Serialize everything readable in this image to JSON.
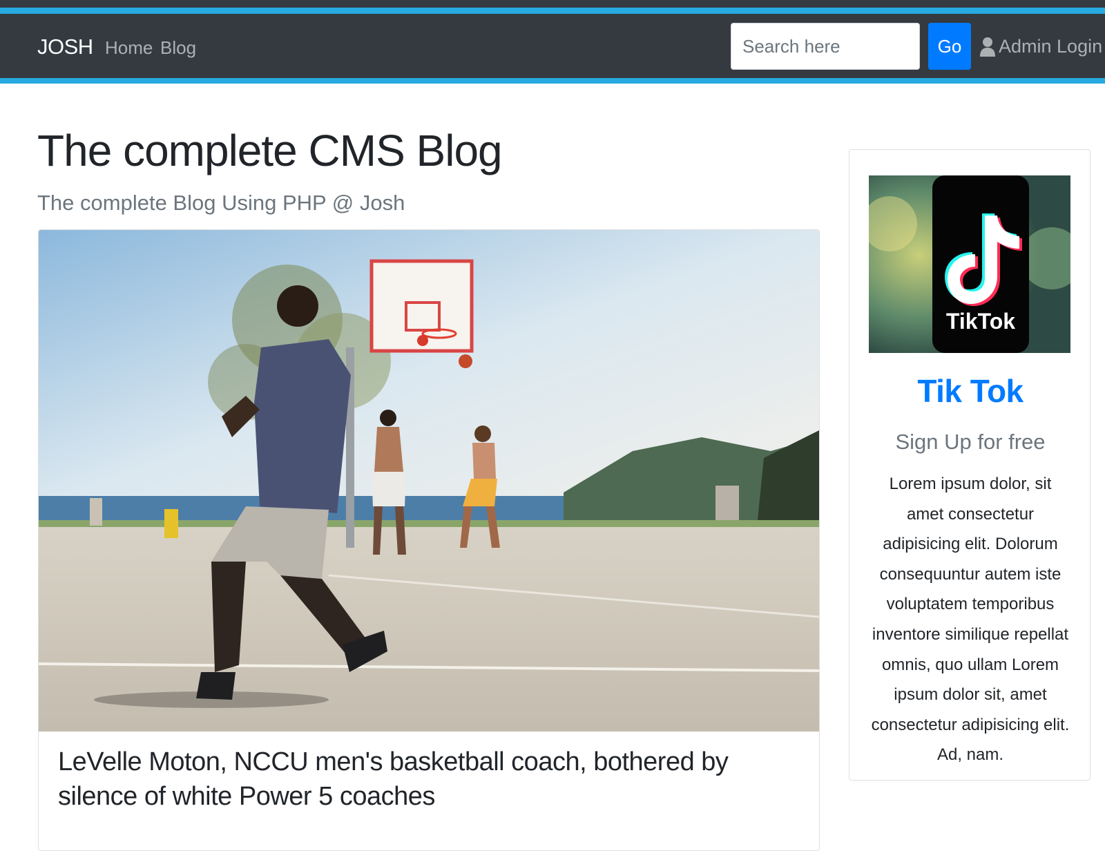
{
  "navbar": {
    "brand": "JOSH",
    "links": [
      {
        "label": "Home"
      },
      {
        "label": "Blog"
      }
    ],
    "search": {
      "placeholder": "Search here",
      "value": ""
    },
    "go_label": "Go",
    "admin_login_label": "Admin Login",
    "user_icon": "user-icon"
  },
  "colors": {
    "navbar_bg": "#343a40",
    "accent": "#27aae1",
    "primary": "#007bff"
  },
  "page": {
    "title": "The complete CMS Blog",
    "subtitle": "The complete Blog Using PHP @ Josh"
  },
  "post": {
    "title": "LeVelle Moton, NCCU men's basketball coach, bothered by silence of white Power 5 coaches"
  },
  "sidebar": {
    "ad_image_text": "TikTok",
    "ad_title": "Tik Tok",
    "ad_subtitle": "Sign Up for free",
    "ad_text": "Lorem ipsum dolor, sit amet consectetur adipisicing elit. Dolorum consequuntur autem iste voluptatem temporibus inventore similique repellat omnis, quo ullam Lorem ipsum dolor sit, amet consectetur adipisicing elit. Ad, nam."
  }
}
